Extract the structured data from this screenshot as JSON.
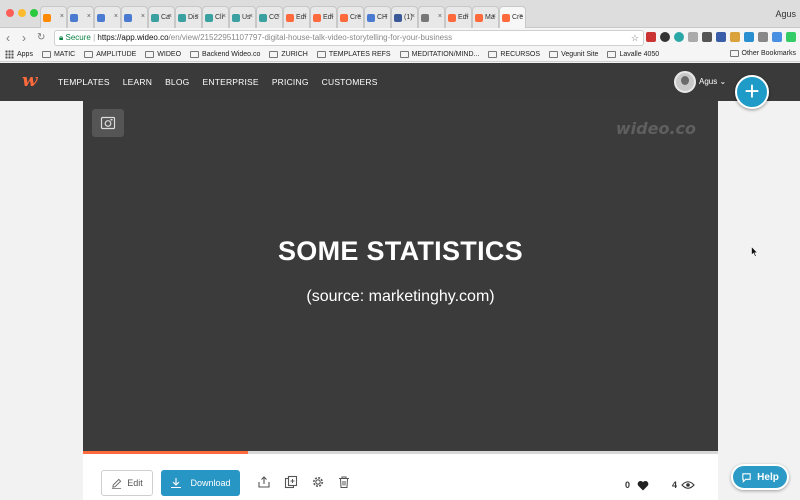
{
  "browser": {
    "tabs": [
      {
        "label": "",
        "color": "#ff8a00"
      },
      {
        "label": "",
        "color": "#4a7bd0"
      },
      {
        "label": "",
        "color": "#4a7bd0"
      },
      {
        "label": "",
        "color": "#4a7bd0"
      },
      {
        "label": "Ca",
        "color": "#3aa0a0"
      },
      {
        "label": "Dis",
        "color": "#3aa0a0"
      },
      {
        "label": "Cli",
        "color": "#3aa0a0"
      },
      {
        "label": "Us",
        "color": "#3aa0a0"
      },
      {
        "label": "CC",
        "color": "#3aa0a0"
      },
      {
        "label": "Edi",
        "color": "#ff6a3d"
      },
      {
        "label": "Edi",
        "color": "#ff6a3d"
      },
      {
        "label": "Cre",
        "color": "#ff6a3d"
      },
      {
        "label": "CH",
        "color": "#4a7bd0"
      },
      {
        "label": "(1)",
        "color": "#3b5998"
      },
      {
        "label": "",
        "color": "#777777"
      },
      {
        "label": "Edi",
        "color": "#ff6a3d"
      },
      {
        "label": "Ma",
        "color": "#ff6a3d"
      },
      {
        "label": "Cre",
        "color": "#ff6a3d"
      }
    ],
    "profile_name": "Agus",
    "secure_label": "Secure",
    "url_host": "https://app.wideo.co",
    "url_path": "/en/view/21522951107797-digital-house-talk-video-storytelling-for-your-business",
    "bookmarks": [
      "Apps",
      "MATIC",
      "AMPLITUDE",
      "WIDEO",
      "Backend Wideo.co",
      "ZURICH",
      "TEMPLATES REFS",
      "MEDITATION/MIND...",
      "RECURSOS",
      "Vegunit Site",
      "Lavalle 4050"
    ],
    "other_bookmarks": "Other Bookmarks"
  },
  "site": {
    "logo": "w",
    "menu": [
      "TEMPLATES",
      "LEARN",
      "BLOG",
      "ENTERPRISE",
      "PRICING",
      "CUSTOMERS"
    ],
    "user_name": "Agus",
    "add_symbol": "+",
    "accent_color": "#ff6a3d",
    "primary_color": "#2796c4"
  },
  "video": {
    "watermark": "wideo.co",
    "title": "SOME STATISTICS",
    "subtitle": "(source: marketinghy.com)",
    "progress": 0.26
  },
  "controls": {
    "edit_label": "Edit",
    "download_label": "Download",
    "likes": "0",
    "views": "4"
  },
  "help_label": "Help"
}
